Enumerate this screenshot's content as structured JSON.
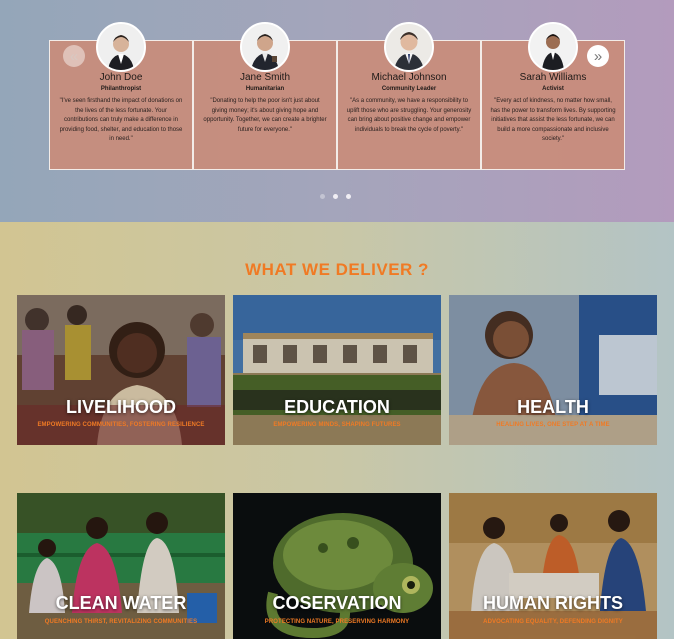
{
  "testimonials": {
    "prev_icon": "«",
    "next_icon": "»",
    "items": [
      {
        "name": "John Doe",
        "role": "Philanthropist",
        "quote": "\"I've seen firsthand the impact of donations on the lives of the less fortunate. Your contributions can truly make a difference in providing food, shelter, and education to those in need.\""
      },
      {
        "name": "Jane Smith",
        "role": "Humanitarian",
        "quote": "\"Donating to help the poor isn't just about giving money; it's about giving hope and opportunity. Together, we can create a brighter future for everyone.\""
      },
      {
        "name": "Michael Johnson",
        "role": "Community Leader",
        "quote": "\"As a community, we have a responsibility to uplift those who are struggling. Your generosity can bring about positive change and empower individuals to break the cycle of poverty.\""
      },
      {
        "name": "Sarah Williams",
        "role": "Activist",
        "quote": "\"Every act of kindness, no matter how small, has the power to transform lives. By supporting initiatives that assist the less fortunate, we can build a more compassionate and inclusive society.\""
      }
    ]
  },
  "deliver": {
    "title": "WHAT WE DELIVER ?",
    "accent_color": "#f07a24",
    "tiles": [
      {
        "title": "LIVELIHOOD",
        "subtitle": "EMPOWERING COMMUNITIES, FOSTERING RESILIENCE"
      },
      {
        "title": "EDUCATION",
        "subtitle": "EMPOWERING MINDS, SHAPING FUTURES"
      },
      {
        "title": "HEALTH",
        "subtitle": "HEALING LIVES, ONE STEP AT A TIME"
      },
      {
        "title": "CLEAN WATER",
        "subtitle": "QUENCHING THIRST, REVITALIZING COMMUNITIES"
      },
      {
        "title": "COSERVATION",
        "subtitle": "PROTECTING NATURE, PRESERVING HARMONY"
      },
      {
        "title": "HUMAN RIGHTS",
        "subtitle": "ADVOCATING EQUALITY, DEFENDING DIGNITY"
      }
    ]
  }
}
